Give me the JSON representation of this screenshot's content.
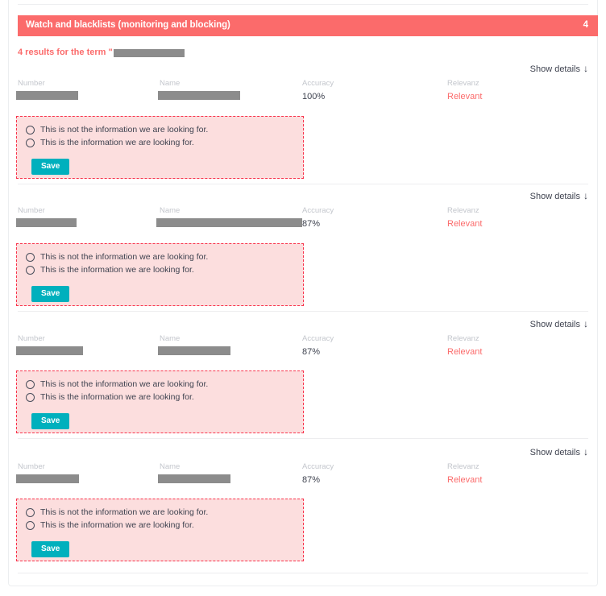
{
  "section": {
    "title": "Watch and blacklists (monitoring and blocking)",
    "count": "4",
    "header_color": "#fb6b6b"
  },
  "results_summary": {
    "prefix": "4 results for the term \"",
    "redacted_term": ""
  },
  "columns": {
    "number": "Number",
    "name": "Name",
    "accuracy": "Accuracy",
    "relevanz": "Relevanz"
  },
  "show_details": {
    "label": "Show details",
    "arrow_icon": "↓"
  },
  "feedback": {
    "option_negative": "This is not the information we are looking for.",
    "option_positive": "This is the information we are looking for.",
    "save_label": "Save",
    "save_color": "#00b0bd",
    "border_color": "#f8334c",
    "background_color": "#fcdede"
  },
  "results": [
    {
      "number_redacted": "",
      "name_redacted": "",
      "accuracy": "100%",
      "relevanz": "Relevant"
    },
    {
      "number_redacted": "",
      "name_redacted": "",
      "accuracy": "87%",
      "relevanz": "Relevant"
    },
    {
      "number_redacted": "",
      "name_redacted": "",
      "accuracy": "87%",
      "relevanz": "Relevant"
    },
    {
      "number_redacted": "",
      "name_redacted": "",
      "accuracy": "87%",
      "relevanz": "Relevant"
    }
  ]
}
